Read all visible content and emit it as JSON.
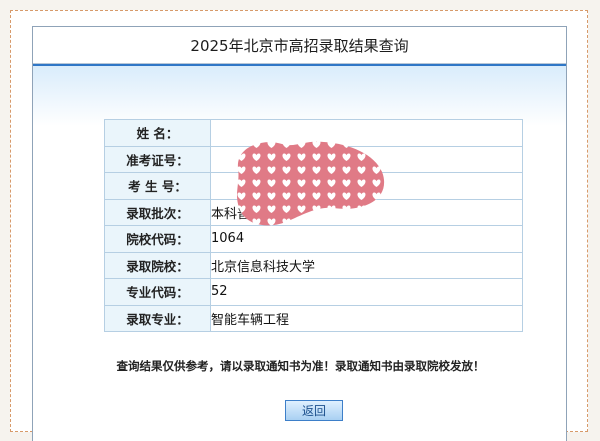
{
  "title": "2025年北京市高招录取结果查询",
  "rows": [
    {
      "label": "姓    名：",
      "value": ""
    },
    {
      "label": "准考证号：",
      "value": ""
    },
    {
      "label": "考 生 号：",
      "value": ""
    },
    {
      "label": "录取批次：",
      "value": "本科普通批"
    },
    {
      "label": "院校代码：",
      "value": "1064"
    },
    {
      "label": "录取院校：",
      "value": "北京信息科技大学"
    },
    {
      "label": "专业代码：",
      "value": "52"
    },
    {
      "label": "录取专业：",
      "value": "智能车辆工程"
    }
  ],
  "notice": "查询结果仅供参考，请以录取通知书为准！录取通知书由录取院校发放！",
  "back_label": "返回",
  "privacy_sticker": {
    "shape": "heart-pattern-blob",
    "color": "#e07a86"
  }
}
